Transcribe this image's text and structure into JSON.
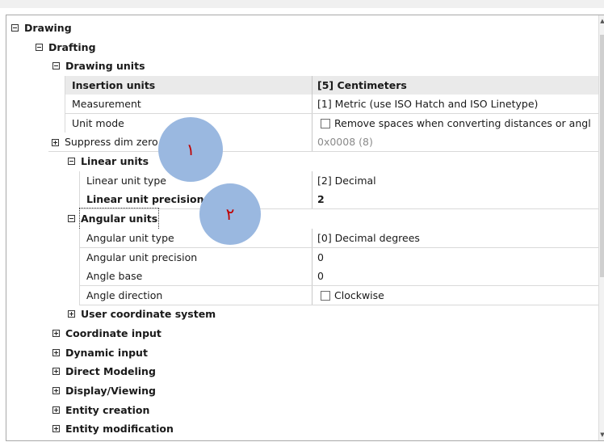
{
  "tree": {
    "drawing": "Drawing",
    "drafting": "Drafting",
    "drawing_units": "Drawing units",
    "linear_units": "Linear units",
    "angular_units": "Angular units",
    "user_coordinate_system": "User coordinate system",
    "coordinate_input": "Coordinate input",
    "dynamic_input": "Dynamic input",
    "direct_modeling": "Direct Modeling",
    "display_viewing": "Display/Viewing",
    "entity_creation": "Entity creation",
    "entity_modification": "Entity modification"
  },
  "drawing_units": {
    "header_label": "Insertion units",
    "header_value": "[5] Centimeters",
    "measurement_label": "Measurement",
    "measurement_value": "[1] Metric (use ISO Hatch and ISO Linetype)",
    "unit_mode_label": "Unit mode",
    "unit_mode_value": "Remove spaces when converting distances or angl",
    "suppress_label": "Suppress dim zero",
    "suppress_value": "0x0008 (8)"
  },
  "linear_units": {
    "type_label": "Linear unit type",
    "type_value": "[2] Decimal",
    "precision_label": "Linear unit precision",
    "precision_value": "2"
  },
  "angular_units": {
    "type_label": "Angular unit type",
    "type_value": "[0] Decimal degrees",
    "precision_label": "Angular unit precision",
    "precision_value": "0",
    "base_label": "Angle base",
    "base_value": "0",
    "direction_label": "Angle direction",
    "direction_value": "Clockwise"
  },
  "annotations": {
    "marker_1": "١",
    "marker_2": "٢"
  },
  "colors": {
    "marker_fill": "#9ab8e0",
    "marker_text": "#c00000",
    "header_row": "#eaeaea"
  }
}
